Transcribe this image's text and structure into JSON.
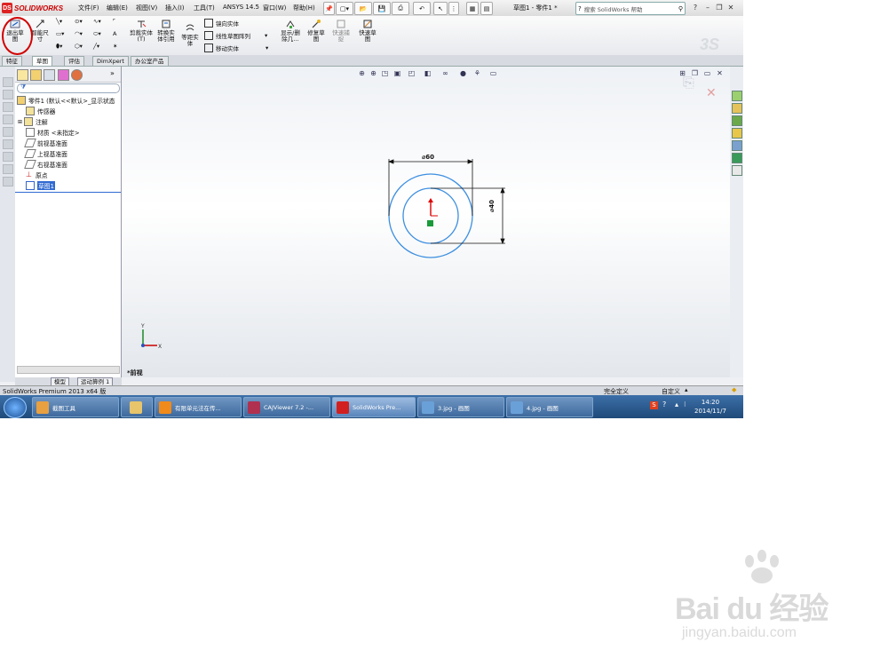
{
  "app": {
    "logo_text": "SOLIDWORKS",
    "title": "草图1 - 零件1 *"
  },
  "menu": [
    "文件(F)",
    "编辑(E)",
    "视图(V)",
    "插入(I)",
    "工具(T)",
    "ANSYS 14.5",
    "窗口(W)",
    "帮助(H)"
  ],
  "search": {
    "placeholder": "搜索 SolidWorks 帮助"
  },
  "ribbon": {
    "exit_sketch": "退出草图",
    "smart_dim": "智能尺寸",
    "trim": "剪裁实体(T)",
    "convert": "转换实体引用",
    "offset": "等距实体",
    "mirror": "镜向实体",
    "linear_pattern": "线性草图阵列",
    "move": "移动实体",
    "show_delete": "显示/删除几…",
    "repair": "修复草图",
    "quick_snap": "快速捕捉",
    "rapid_sketch": "快速草图"
  },
  "tabs": [
    "特征",
    "草图",
    "评估",
    "DimXpert",
    "办公室产品"
  ],
  "tree": {
    "root": "零件1 (默认<<默认>_显示状态",
    "items": [
      "传感器",
      "注解",
      "材质 <未指定>",
      "前视基准面",
      "上视基准面",
      "右视基准面",
      "原点"
    ],
    "selected": "草图1"
  },
  "bottom_tabs": [
    "模型",
    "运动算例 1"
  ],
  "view_label": "*前视",
  "dims": {
    "outer": "⌀60",
    "inner": "⌀40"
  },
  "status": {
    "left": "SolidWorks Premium 2013 x64 版",
    "mid": "完全定义",
    "right": "自定义"
  },
  "taskbar": [
    {
      "label": "截图工具",
      "color": "#e8a040"
    },
    {
      "label": "",
      "color": "#e8c46a"
    },
    {
      "label": "有限单元法在传...",
      "color": "#f08a1a"
    },
    {
      "label": "CAJViewer 7.2 -...",
      "color": "#b03050"
    },
    {
      "label": "SolidWorks Pre...",
      "color": "#d22020"
    },
    {
      "label": "3.jpg - 画图",
      "color": "#6aa0d8"
    },
    {
      "label": "4.jpg - 画图",
      "color": "#6aa0d8"
    }
  ],
  "clock": {
    "time": "14:20",
    "date": "2014/11/7"
  },
  "watermark": {
    "brand": "Bai du 经验",
    "url": "jingyan.baidu.com"
  },
  "colors": {
    "accent": "#2f6ad1",
    "circle": "#3d8fe0",
    "exit_highlight": "#d20000"
  }
}
